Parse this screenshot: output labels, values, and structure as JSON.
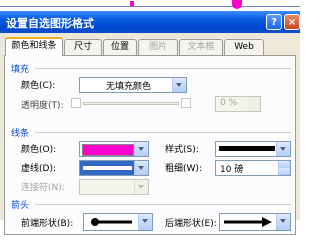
{
  "dialog": {
    "title": "设置自选图形格式",
    "buttons": {
      "help": "?",
      "close": "×"
    }
  },
  "tabs": [
    {
      "label": "颜色和线条",
      "active": true
    },
    {
      "label": "尺寸"
    },
    {
      "label": "位置"
    },
    {
      "label": "图片",
      "disabled": true
    },
    {
      "label": "文本框",
      "disabled": true
    },
    {
      "label": "Web"
    }
  ],
  "fill": {
    "heading": "填充",
    "color_label": "颜色(C):",
    "color_value": "无填充颜色",
    "transparency_label": "透明度(T):",
    "transparency_value": "0 %"
  },
  "line": {
    "heading": "线条",
    "color_label": "颜色(O):",
    "color_value": "#ff00cc",
    "style_label": "样式(S):",
    "dash_label": "虚线(D):",
    "weight_label": "粗细(W):",
    "weight_value": "10 磅",
    "connector_label": "连接符(N):"
  },
  "arrows": {
    "heading": "箭头",
    "begin_style_label": "前端形状(B):",
    "end_style_label": "后端形状(E):"
  },
  "colors": {
    "title_bar": "#0a5fe0",
    "line_color": "#ff00cc",
    "accent": "#0046d5"
  }
}
